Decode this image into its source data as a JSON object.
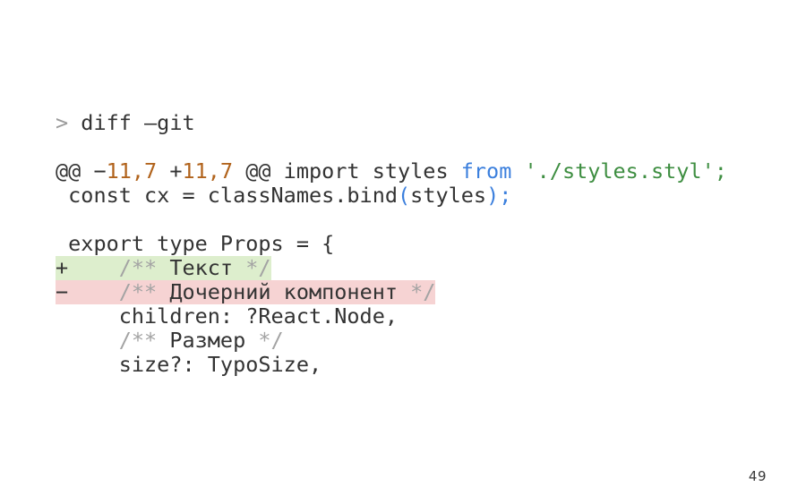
{
  "slide": {
    "page_number": "49",
    "background_color": "#ffffff",
    "colors": {
      "text": "#333333",
      "gray": "#9a9a9a",
      "number": "#b1631c",
      "keyword": "#3b7fdd",
      "string": "#3e8e41",
      "punctuation": "#3b7fdd",
      "comment": "#a3a3a3",
      "added_background": "#ddeecd",
      "removed_background": "#f6d3d3"
    }
  },
  "code": {
    "lines": [
      {
        "id": "line-command",
        "kind": "command",
        "text": "> diff —git",
        "tokens": [
          {
            "t": "> ",
            "c": "tok-gray"
          },
          {
            "t": "diff —git",
            "c": "tok-default"
          }
        ]
      },
      {
        "id": "line-blank-1",
        "kind": "blank",
        "text": " ",
        "tokens": [
          {
            "t": " ",
            "c": "tok-default"
          }
        ]
      },
      {
        "id": "line-hunk-header",
        "kind": "hunk",
        "text": "@@ −11,7 +11,7 @@ import styles from './styles.styl';",
        "tokens": [
          {
            "t": "@@ −",
            "c": "tok-default"
          },
          {
            "t": "11,7",
            "c": "tok-num"
          },
          {
            "t": " +",
            "c": "tok-default"
          },
          {
            "t": "11,7",
            "c": "tok-num"
          },
          {
            "t": " @@ import styles ",
            "c": "tok-default"
          },
          {
            "t": "from",
            "c": "tok-keyword"
          },
          {
            "t": " ",
            "c": "tok-default"
          },
          {
            "t": "'./styles.styl';",
            "c": "tok-string"
          }
        ]
      },
      {
        "id": "line-context-const",
        "kind": "context",
        "text": " const cx = classNames.bind(styles);",
        "tokens": [
          {
            "t": " const cx = classNames.bind",
            "c": "tok-default"
          },
          {
            "t": "(",
            "c": "tok-punct"
          },
          {
            "t": "styles",
            "c": "tok-default"
          },
          {
            "t": ");",
            "c": "tok-punct"
          }
        ]
      },
      {
        "id": "line-blank-2",
        "kind": "blank",
        "text": " ",
        "tokens": [
          {
            "t": " ",
            "c": "tok-default"
          }
        ]
      },
      {
        "id": "line-context-export",
        "kind": "context",
        "text": " export type Props = {",
        "tokens": [
          {
            "t": " export type Props = {",
            "c": "tok-default"
          }
        ]
      },
      {
        "id": "line-added-tekst",
        "kind": "added",
        "text": "+    /** Текст */",
        "tokens": [
          {
            "t": "+    ",
            "c": "tok-default"
          },
          {
            "t": "/** ",
            "c": "tok-comment"
          },
          {
            "t": "Текст",
            "c": "tok-commenttext"
          },
          {
            "t": " */",
            "c": "tok-comment"
          }
        ]
      },
      {
        "id": "line-removed-docherniy",
        "kind": "removed",
        "text": "−    /** Дочерний компонент */",
        "tokens": [
          {
            "t": "−    ",
            "c": "tok-default"
          },
          {
            "t": "/** ",
            "c": "tok-comment"
          },
          {
            "t": "Дочерний компонент",
            "c": "tok-commenttext"
          },
          {
            "t": " */",
            "c": "tok-comment"
          }
        ]
      },
      {
        "id": "line-context-children",
        "kind": "context",
        "text": "     children: ?React.Node,",
        "tokens": [
          {
            "t": "     children: ?React.Node,",
            "c": "tok-default"
          }
        ]
      },
      {
        "id": "line-context-comment-razmer",
        "kind": "context",
        "text": "     /** Размер */",
        "tokens": [
          {
            "t": "     ",
            "c": "tok-default"
          },
          {
            "t": "/** ",
            "c": "tok-comment"
          },
          {
            "t": "Размер",
            "c": "tok-commenttext"
          },
          {
            "t": " */",
            "c": "tok-comment"
          }
        ]
      },
      {
        "id": "line-context-size",
        "kind": "context",
        "text": "     size?: TypoSize,",
        "tokens": [
          {
            "t": "     size?: TypoSize,",
            "c": "tok-default"
          }
        ]
      }
    ]
  }
}
